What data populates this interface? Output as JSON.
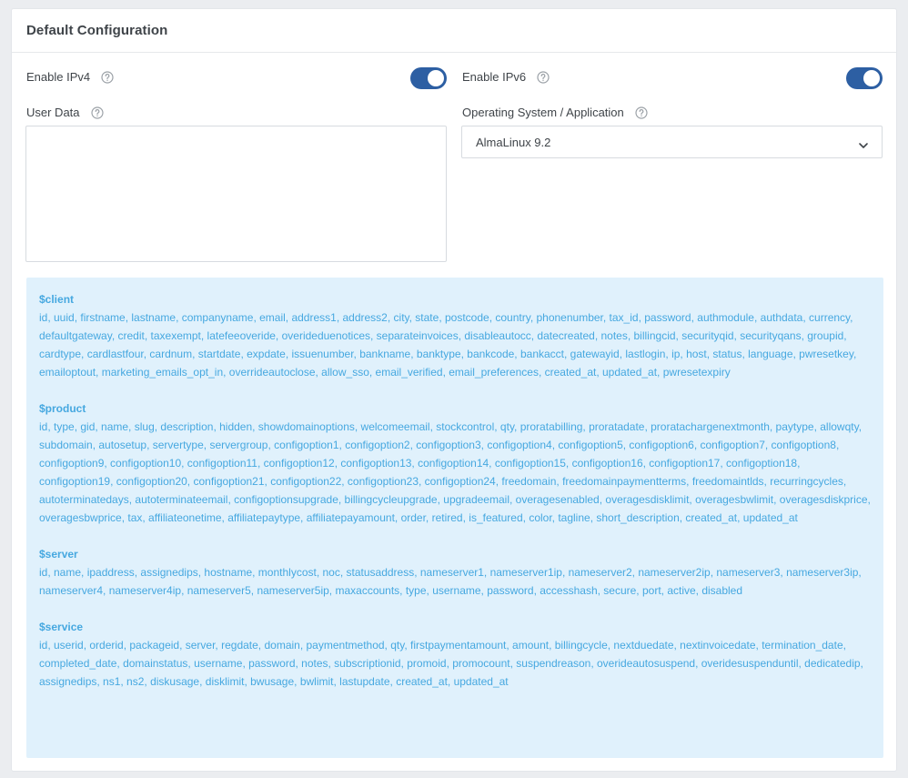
{
  "card": {
    "title": "Default Configuration"
  },
  "fields": {
    "ipv4": {
      "label": "Enable IPv4",
      "enabled": true
    },
    "ipv6": {
      "label": "Enable IPv6",
      "enabled": true
    },
    "user_data": {
      "label": "User Data",
      "value": ""
    },
    "os": {
      "label": "Operating System / Application",
      "selected": "AlmaLinux 9.2"
    }
  },
  "colors": {
    "toggle_on": "#2d5fa3",
    "info_bg": "#e0f1fc",
    "info_text": "#46a8e0"
  },
  "icons": {
    "help": "question-circle-icon",
    "chevron": "chevron-down-icon"
  },
  "variables": {
    "client": {
      "title": "$client",
      "list": "id, uuid, firstname, lastname, companyname, email, address1, address2, city, state, postcode, country, phonenumber, tax_id, password, authmodule, authdata, currency, defaultgateway, credit, taxexempt, latefeeoveride, overideduenotices, separateinvoices, disableautocc, datecreated, notes, billingcid, securityqid, securityqans, groupid, cardtype, cardlastfour, cardnum, startdate, expdate, issuenumber, bankname, banktype, bankcode, bankacct, gatewayid, lastlogin, ip, host, status, language, pwresetkey, emailoptout, marketing_emails_opt_in, overrideautoclose, allow_sso, email_verified, email_preferences, created_at, updated_at, pwresetexpiry"
    },
    "product": {
      "title": "$product",
      "list": "id, type, gid, name, slug, description, hidden, showdomainoptions, welcomeemail, stockcontrol, qty, proratabilling, proratadate, proratachargenextmonth, paytype, allowqty, subdomain, autosetup, servertype, servergroup, configoption1, configoption2, configoption3, configoption4, configoption5, configoption6, configoption7, configoption8, configoption9, configoption10, configoption11, configoption12, configoption13, configoption14, configoption15, configoption16, configoption17, configoption18, configoption19, configoption20, configoption21, configoption22, configoption23, configoption24, freedomain, freedomainpaymentterms, freedomaintlds, recurringcycles, autoterminatedays, autoterminateemail, configoptionsupgrade, billingcycleupgrade, upgradeemail, overagesenabled, overagesdisklimit, overagesbwlimit, overagesdiskprice, overagesbwprice, tax, affiliateonetime, affiliatepaytype, affiliatepayamount, order, retired, is_featured, color, tagline, short_description, created_at, updated_at"
    },
    "server": {
      "title": "$server",
      "list": "id, name, ipaddress, assignedips, hostname, monthlycost, noc, statusaddress, nameserver1, nameserver1ip, nameserver2, nameserver2ip, nameserver3, nameserver3ip, nameserver4, nameserver4ip, nameserver5, nameserver5ip, maxaccounts, type, username, password, accesshash, secure, port, active, disabled"
    },
    "service": {
      "title": "$service",
      "list": "id, userid, orderid, packageid, server, regdate, domain, paymentmethod, qty, firstpaymentamount, amount, billingcycle, nextduedate, nextinvoicedate, termination_date, completed_date, domainstatus, username, password, notes, subscriptionid, promoid, promocount, suspendreason, overideautosuspend, overidesuspenduntil, dedicatedip, assignedips, ns1, ns2, diskusage, disklimit, bwusage, bwlimit, lastupdate, created_at, updated_at"
    }
  }
}
